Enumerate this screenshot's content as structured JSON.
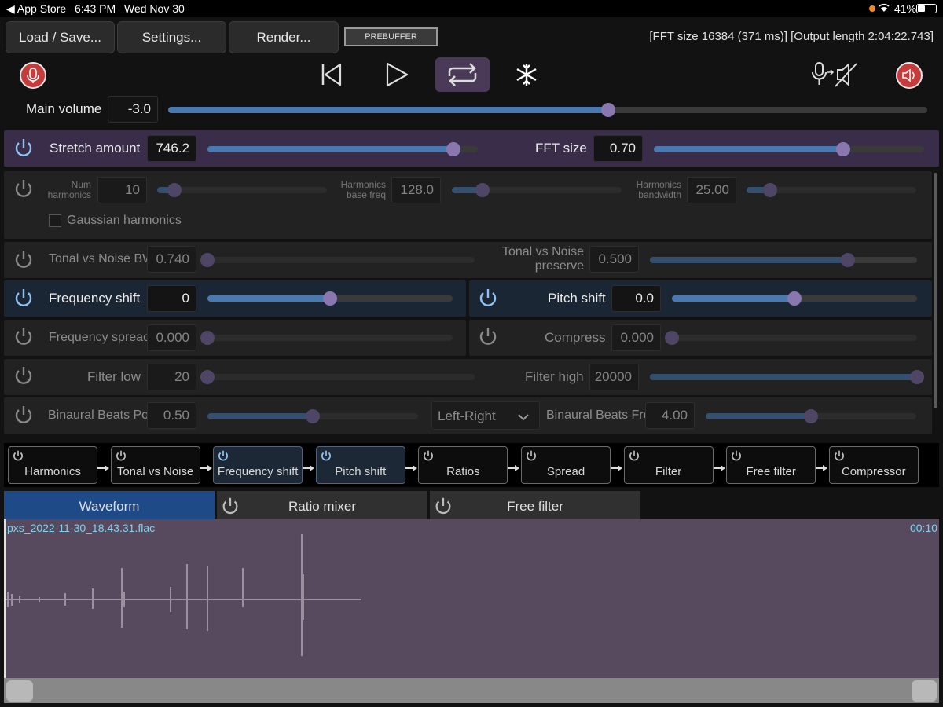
{
  "status": {
    "carrier": "App Store",
    "time": "6:43 PM",
    "date": "Wed Nov 30",
    "battery": "41%"
  },
  "toolbar": {
    "load_save": "Load / Save...",
    "settings": "Settings...",
    "render": "Render...",
    "prebuffer": "PREBUFFER",
    "info": "[FFT size 16384 (371 ms)] [Output length 2:04:22.743]"
  },
  "main_volume": {
    "label": "Main volume",
    "value": "-3.0",
    "level": 0.58
  },
  "stretch": {
    "label": "Stretch amount",
    "value": "746.2",
    "level": 0.91
  },
  "fft": {
    "label": "FFT size",
    "value": "0.70",
    "level": 0.7
  },
  "harmonics": {
    "num_label1": "Num",
    "num_label2": "harmonics",
    "num_value": "10",
    "num_level": 0.1,
    "base_label1": "Harmonics",
    "base_label2": "base freq",
    "base_value": "128.0",
    "base_level": 0.18,
    "bw_label1": "Harmonics",
    "bw_label2": "bandwidth",
    "bw_value": "25.00",
    "bw_level": 0.14,
    "gaussian": "Gaussian harmonics"
  },
  "tonal": {
    "bw_label": "Tonal vs Noise BW",
    "bw_value": "0.740",
    "bw_level": 0.0,
    "pres_label1": "Tonal vs Noise",
    "pres_label2": "preserve",
    "pres_value": "0.500",
    "pres_level": 0.74
  },
  "freq_shift": {
    "label": "Frequency shift",
    "value": "0",
    "level": 0.5
  },
  "pitch_shift": {
    "label": "Pitch shift",
    "value": "0.0",
    "level": 0.5
  },
  "freq_spread": {
    "label": "Frequency spread",
    "value": "0.000",
    "level": 0.0
  },
  "compress": {
    "label": "Compress",
    "value": "0.000",
    "level": 0.0
  },
  "filter_low": {
    "label": "Filter low",
    "value": "20",
    "level": 0.0
  },
  "filter_high": {
    "label": "Filter high",
    "value": "20000",
    "level": 1.0
  },
  "binaural": {
    "power_label": "Binaural Beats Power",
    "power_value": "0.50",
    "power_level": 0.5,
    "mode": "Left-Right",
    "freq_label": "Binaural Beats Freq",
    "freq_value": "4.00",
    "freq_level": 0.5
  },
  "chain": [
    "Harmonics",
    "Tonal vs Noise",
    "Frequency shift",
    "Pitch shift",
    "Ratios",
    "Spread",
    "Filter",
    "Free filter",
    "Compressor"
  ],
  "tabs": {
    "waveform": "Waveform",
    "ratio_mixer": "Ratio mixer",
    "free_filter": "Free filter"
  },
  "waveform": {
    "filename": "pxs_2022-11-30_18.43.31.flac",
    "time": "00:10"
  },
  "colors": {
    "accent": "#8b77b0",
    "slider_fill": "#4a79b0",
    "active_tab": "#1e4a87",
    "waveform_bg": "#574a5e",
    "record_red": "#c63c3c"
  }
}
